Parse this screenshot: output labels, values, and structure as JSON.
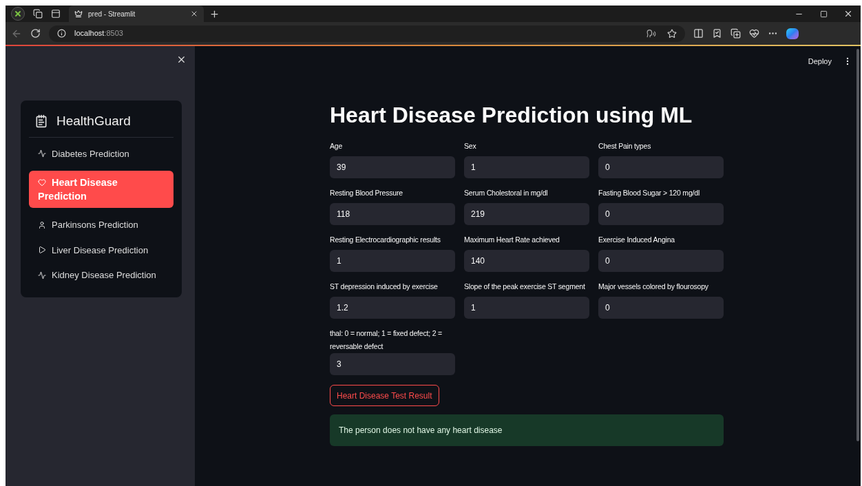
{
  "browser": {
    "tabs": [
      {
        "title": "pred - Streamlit",
        "selected": true
      }
    ],
    "address": {
      "host": "localhost",
      "port": ":8503"
    }
  },
  "header": {
    "deploy": "Deploy"
  },
  "sidebar": {
    "brand": "HealthGuard",
    "items": [
      {
        "label": "Diabetes Prediction",
        "kind": "pulse",
        "selected": false
      },
      {
        "label": "Heart Disease Prediction",
        "kind": "heart",
        "selected": true
      },
      {
        "label": "Parkinsons Prediction",
        "kind": "person",
        "selected": false
      },
      {
        "label": "Liver Disease Prediction",
        "kind": "play",
        "selected": false
      },
      {
        "label": "Kidney Disease Prediction",
        "kind": "pulse",
        "selected": false
      }
    ]
  },
  "main": {
    "title": "Heart Disease Prediction using ML",
    "fields": [
      {
        "label": "Age",
        "value": "39"
      },
      {
        "label": "Sex",
        "value": "1"
      },
      {
        "label": "Chest Pain types",
        "value": "0"
      },
      {
        "label": "Resting Blood Pressure",
        "value": "118"
      },
      {
        "label": "Serum Cholestoral in mg/dl",
        "value": "219"
      },
      {
        "label": "Fasting Blood Sugar > 120 mg/dl",
        "value": "0"
      },
      {
        "label": "Resting Electrocardiographic results",
        "value": "1"
      },
      {
        "label": "Maximum Heart Rate achieved",
        "value": "140"
      },
      {
        "label": "Exercise Induced Angina",
        "value": "0"
      },
      {
        "label": "ST depression induced by exercise",
        "value": "1.2"
      },
      {
        "label": "Slope of the peak exercise ST segment",
        "value": "1"
      },
      {
        "label": "Major vessels colored by flourosopy",
        "value": "0"
      },
      {
        "label": "thal: 0 = normal; 1 = fixed defect; 2 = reversable defect",
        "value": "3"
      }
    ],
    "button": "Heart Disease Test Result",
    "result": "The person does not have any heart disease"
  }
}
